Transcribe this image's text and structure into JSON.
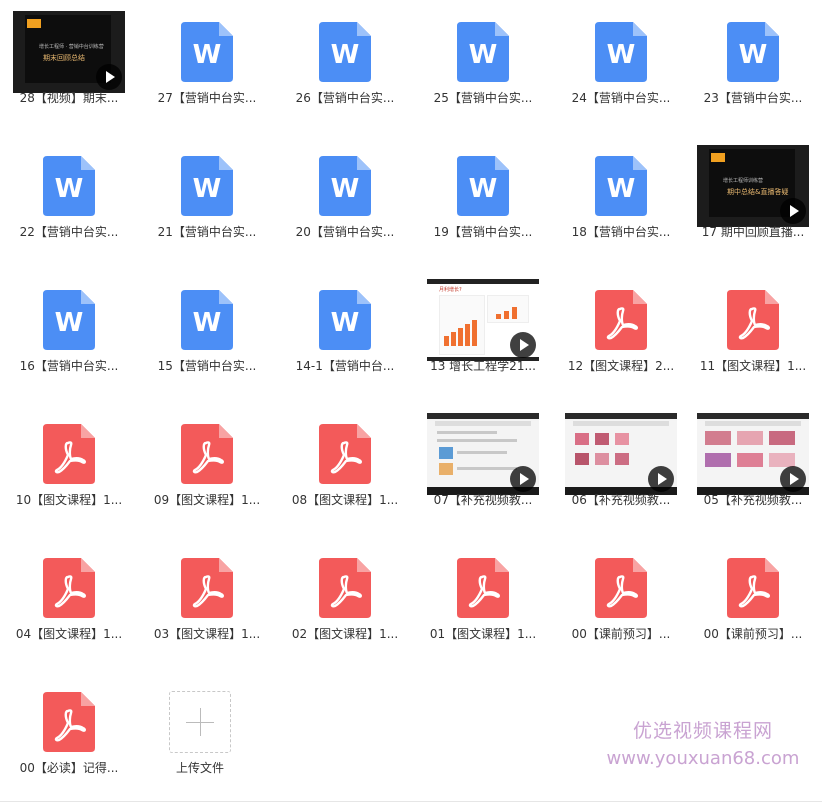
{
  "colors": {
    "word_blue": "#4c8ef5",
    "pdf_red": "#f35a5a",
    "watermark": "#c9a3d2",
    "label": "#333333"
  },
  "icons": {
    "word": "word-file-icon",
    "pdf": "pdf-file-icon",
    "video": "video-play-icon",
    "upload": "plus-icon"
  },
  "thumbs": {
    "v28_line1": "增长工程师 · 营销中台训练营",
    "v28_line2": "期末回顾总结",
    "v17_line1": "增长工程师训练营",
    "v17_line2": "期中总结&直播答疑",
    "v13_title": "月利增长?"
  },
  "files": [
    {
      "name": "28【视频】期末...",
      "type": "video"
    },
    {
      "name": "27【营销中台实...",
      "type": "word"
    },
    {
      "name": "26【营销中台实...",
      "type": "word"
    },
    {
      "name": "25【营销中台实...",
      "type": "word"
    },
    {
      "name": "24【营销中台实...",
      "type": "word"
    },
    {
      "name": "23【营销中台实...",
      "type": "word"
    },
    {
      "name": "22【营销中台实...",
      "type": "word"
    },
    {
      "name": "21【营销中台实...",
      "type": "word"
    },
    {
      "name": "20【营销中台实...",
      "type": "word"
    },
    {
      "name": "19【营销中台实...",
      "type": "word"
    },
    {
      "name": "18【营销中台实...",
      "type": "word"
    },
    {
      "name": "17 期中回顾直播...",
      "type": "video"
    },
    {
      "name": "16【营销中台实...",
      "type": "word"
    },
    {
      "name": "15【营销中台实...",
      "type": "word"
    },
    {
      "name": "14-1【营销中台...",
      "type": "word"
    },
    {
      "name": "13 增长工程学21...",
      "type": "video"
    },
    {
      "name": "12【图文课程】2...",
      "type": "pdf"
    },
    {
      "name": "11【图文课程】1...",
      "type": "pdf"
    },
    {
      "name": "10【图文课程】1...",
      "type": "pdf"
    },
    {
      "name": "09【图文课程】1...",
      "type": "pdf"
    },
    {
      "name": "08【图文课程】1...",
      "type": "pdf"
    },
    {
      "name": "07【补充视频教...",
      "type": "video"
    },
    {
      "name": "06【补充视频教...",
      "type": "video"
    },
    {
      "name": "05【补充视频教...",
      "type": "video"
    },
    {
      "name": "04【图文课程】1...",
      "type": "pdf"
    },
    {
      "name": "03【图文课程】1...",
      "type": "pdf"
    },
    {
      "name": "02【图文课程】1...",
      "type": "pdf"
    },
    {
      "name": "01【图文课程】1...",
      "type": "pdf"
    },
    {
      "name": "00【课前预习】...",
      "type": "pdf"
    },
    {
      "name": "00【课前预习】...",
      "type": "pdf"
    },
    {
      "name": "00【必读】记得...",
      "type": "pdf"
    }
  ],
  "upload": {
    "label": "上传文件"
  },
  "watermark": {
    "cn": "优选视频课程网",
    "url": "www.youxuan68.com"
  }
}
